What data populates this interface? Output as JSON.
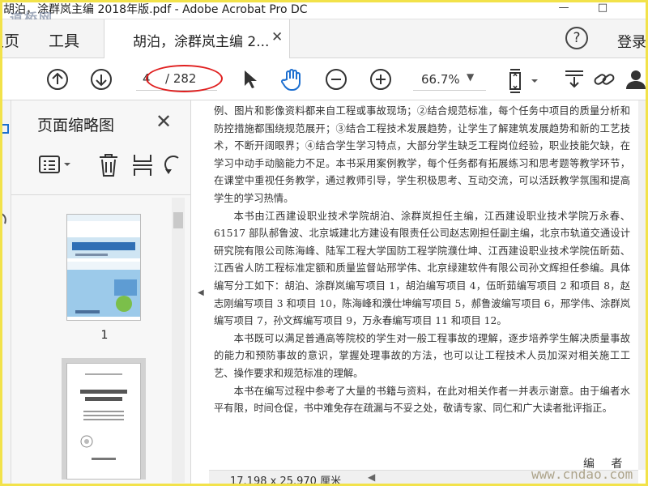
{
  "window": {
    "title": "胡泊，涂群岚主编 2018年版.pdf - Adobe Acrobat Pro DC",
    "watermark_top": "道桥网",
    "minimize": "—",
    "maximize": "□"
  },
  "tabs": {
    "home": "主页",
    "home_visible": "主页",
    "tools": "工具",
    "doc_tab": "胡泊，涂群岚主编 2...",
    "close": "✕",
    "help": "?",
    "login": "登录"
  },
  "toolbar": {
    "current_page": "4",
    "total_pages": "/ 282",
    "zoom": "66.7%",
    "zoom_caret": "▼"
  },
  "thumbnails": {
    "title": "页面缩略图",
    "close": "✕",
    "page1_label": "1"
  },
  "document": {
    "paragraphs": [
      {
        "indent": false,
        "text": "例、图片和影像资料都来自工程或事故现场；②结合规范标准，每个任务中项目的质量分析和防控措施都围绕规范展开；③结合工程技术发展趋势，让学生了解建筑发展趋势和新的工艺技术，不断开阔眼界；④结合学生学习特点，大部分学生缺乏工程岗位经验，职业技能欠缺，在学习中动手动脑能力不足。本书采用案例教学，每个任务都有拓展练习和思考题等教学环节，在课堂中重视任务教学，通过教师引导，学生积极思考、互动交流，可以活跃教学氛围和提高学生的学习热情。"
      },
      {
        "indent": true,
        "text": "本书由江西建设职业技术学院胡泊、涂群岚担任主编，江西建设职业技术学院万永春、61517 部队郝鲁波、北京城建北方建设有限责任公司赵志刚担任副主编，北京市轨道交通设计研究院有限公司陈海峰、陆军工程大学国防工程学院濮仕坤、江西建设职业技术学院伍昕茹、江西省人防工程标准定额和质量监督站邢学伟、北京绿建软件有限公司孙文辉担任参编。具体编写分工如下：胡泊、涂群岚编写项目 1，胡泊编写项目 4，伍昕茹编写项目 2 和项目 8，赵志刚编写项目 3 和项目 10，陈海峰和濮仕坤编写项目 5，郝鲁波编写项目 6，邢学伟、涂群岚编写项目 7，孙文辉编写项目 9，万永春编写项目 11 和项目 12。"
      },
      {
        "indent": true,
        "text": "本书既可以满足普通高等院校的学生对一般工程事故的理解，逐步培养学生解决质量事故的能力和预防事故的意识，掌握处理事故的方法，也可以让工程技术人员加深对相关施工工艺、操作要求和规范标准的理解。"
      },
      {
        "indent": true,
        "text": "本书在编写过程中参考了大量的书籍与资料，在此对相关作者一并表示谢意。由于编者水平有限，时间仓促，书中难免存在疏漏与不妥之处，敬请专家、同仁和广大读者批评指正。"
      }
    ],
    "signature": "编 者",
    "page_size": "17.198 x 25.970 厘米",
    "watermark_bottom": "www.cndao.com"
  },
  "colors": {
    "annotation": "#e02020",
    "frame": "#f2e24a",
    "cover_blue": "#2f6fb5",
    "cover_green": "#7bbf4a"
  }
}
